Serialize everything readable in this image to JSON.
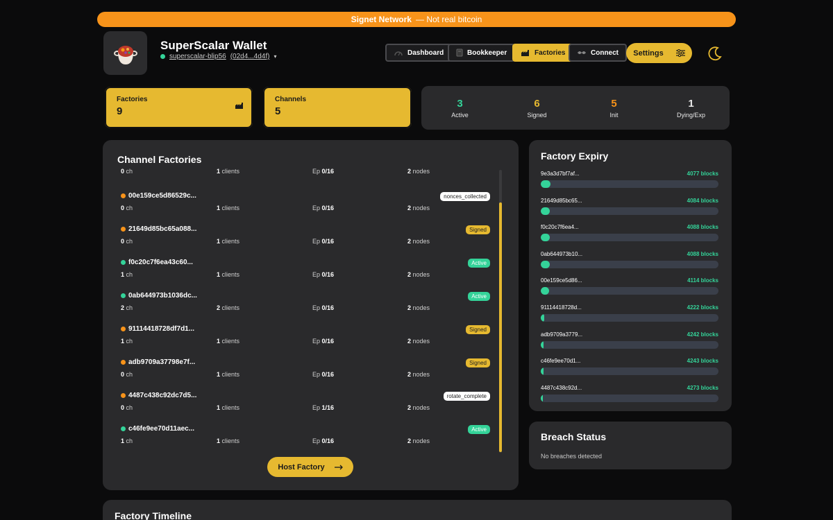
{
  "banner": {
    "network": "Signet Network",
    "note": "— Not real bitcoin"
  },
  "wallet": {
    "title": "SuperScalar Wallet",
    "node_name": "superscalar-blip56",
    "pubkey": "(02d4...4d4f)"
  },
  "nav": {
    "dashboard": "Dashboard",
    "bookkeeper": "Bookkeeper",
    "factories": "Factories",
    "connect": "Connect",
    "settings": "Settings"
  },
  "stats": {
    "factories_label": "Factories",
    "factories_value": "9",
    "channels_label": "Channels",
    "channels_value": "5"
  },
  "status": [
    {
      "num": "3",
      "label": "Active",
      "color": "#34d399"
    },
    {
      "num": "6",
      "label": "Signed",
      "color": "#e6b930"
    },
    {
      "num": "5",
      "label": "Init",
      "color": "#f7931a"
    },
    {
      "num": "1",
      "label": "Dying/Exp",
      "color": "#e8e8e8"
    }
  ],
  "factories_panel": {
    "title": "Channel Factories",
    "rows": [
      {
        "name": "",
        "dot": "none",
        "badge": "",
        "badge_style": "",
        "ch": "0",
        "ch_unit": "ch",
        "clients": "1",
        "clients_unit": "clients",
        "ep_label": "Ep",
        "ep": "0/16",
        "nodes": "2",
        "nodes_unit": "nodes"
      },
      {
        "name": "00e159ce5d86529c...",
        "dot": "orange",
        "badge": "nonces_collected",
        "badge_style": "white",
        "ch": "0",
        "ch_unit": "ch",
        "clients": "1",
        "clients_unit": "clients",
        "ep_label": "Ep",
        "ep": "0/16",
        "nodes": "2",
        "nodes_unit": "nodes"
      },
      {
        "name": "21649d85bc65a088...",
        "dot": "orange",
        "badge": "Signed",
        "badge_style": "yellow",
        "ch": "0",
        "ch_unit": "ch",
        "clients": "1",
        "clients_unit": "clients",
        "ep_label": "Ep",
        "ep": "0/16",
        "nodes": "2",
        "nodes_unit": "nodes"
      },
      {
        "name": "f0c20c7f6ea43c60...",
        "dot": "green",
        "badge": "Active",
        "badge_style": "green",
        "ch": "1",
        "ch_unit": "ch",
        "clients": "1",
        "clients_unit": "clients",
        "ep_label": "Ep",
        "ep": "0/16",
        "nodes": "2",
        "nodes_unit": "nodes"
      },
      {
        "name": "0ab644973b1036dc...",
        "dot": "green",
        "badge": "Active",
        "badge_style": "green",
        "ch": "2",
        "ch_unit": "ch",
        "clients": "2",
        "clients_unit": "clients",
        "ep_label": "Ep",
        "ep": "0/16",
        "nodes": "2",
        "nodes_unit": "nodes"
      },
      {
        "name": "91114418728df7d1...",
        "dot": "orange",
        "badge": "Signed",
        "badge_style": "yellow",
        "ch": "1",
        "ch_unit": "ch",
        "clients": "1",
        "clients_unit": "clients",
        "ep_label": "Ep",
        "ep": "0/16",
        "nodes": "2",
        "nodes_unit": "nodes"
      },
      {
        "name": "adb9709a37798e7f...",
        "dot": "orange",
        "badge": "Signed",
        "badge_style": "yellow",
        "ch": "0",
        "ch_unit": "ch",
        "clients": "1",
        "clients_unit": "clients",
        "ep_label": "Ep",
        "ep": "0/16",
        "nodes": "2",
        "nodes_unit": "nodes"
      },
      {
        "name": "4487c438c92dc7d5...",
        "dot": "orange",
        "badge": "rotate_complete",
        "badge_style": "white",
        "ch": "0",
        "ch_unit": "ch",
        "clients": "1",
        "clients_unit": "clients",
        "ep_label": "Ep",
        "ep": "1/16",
        "nodes": "2",
        "nodes_unit": "nodes"
      },
      {
        "name": "c46fe9ee70d11aec...",
        "dot": "green",
        "badge": "Active",
        "badge_style": "green",
        "ch": "1",
        "ch_unit": "ch",
        "clients": "1",
        "clients_unit": "clients",
        "ep_label": "Ep",
        "ep": "0/16",
        "nodes": "2",
        "nodes_unit": "nodes"
      }
    ],
    "host_button": "Host Factory"
  },
  "expiry": {
    "title": "Factory Expiry",
    "rows": [
      {
        "id": "9e3a3d7bf7af...",
        "blocks": "4077 blocks",
        "fill_pct": 5.5
      },
      {
        "id": "21649d85bc65...",
        "blocks": "4084 blocks",
        "fill_pct": 5
      },
      {
        "id": "f0c20c7f6ea4...",
        "blocks": "4088 blocks",
        "fill_pct": 5
      },
      {
        "id": "0ab644973b10...",
        "blocks": "4088 blocks",
        "fill_pct": 5
      },
      {
        "id": "00e159ce5d86...",
        "blocks": "4114 blocks",
        "fill_pct": 4.5
      },
      {
        "id": "91114418728d...",
        "blocks": "4222 blocks",
        "fill_pct": 2
      },
      {
        "id": "adb9709a3779...",
        "blocks": "4242 blocks",
        "fill_pct": 1.5
      },
      {
        "id": "c46fe9ee70d1...",
        "blocks": "4243 blocks",
        "fill_pct": 1.5
      },
      {
        "id": "4487c438c92d...",
        "blocks": "4273 blocks",
        "fill_pct": 1
      }
    ]
  },
  "breach": {
    "title": "Breach Status",
    "message": "No breaches detected"
  },
  "timeline": {
    "title": "Factory Timeline"
  },
  "colors": {
    "accent": "#e6b930",
    "banner": "#f7931a",
    "active": "#34d399",
    "panel": "#2a2a2c"
  }
}
